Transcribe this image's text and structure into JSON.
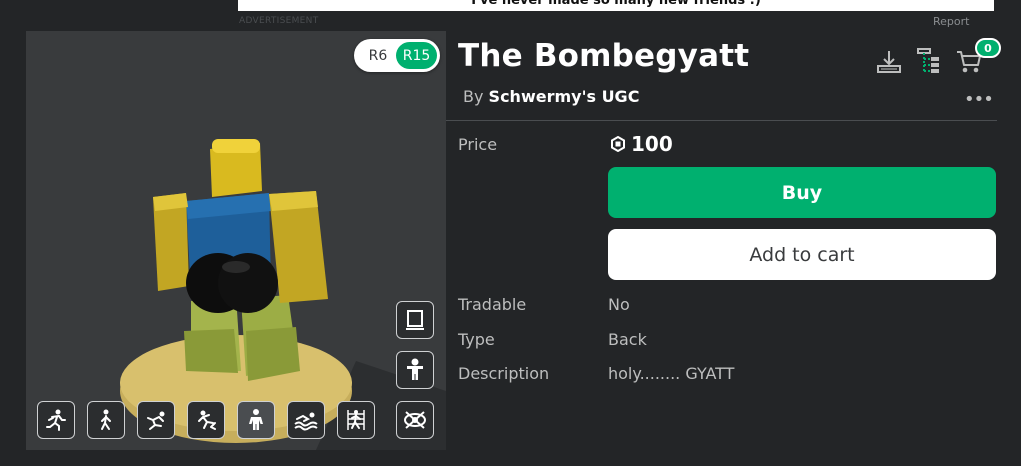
{
  "ad": {
    "banner_text": "I've never made so many new friends :)",
    "label": "ADVERTISEMENT",
    "report": "Report"
  },
  "viewer": {
    "rig_options": [
      "R6",
      "R15"
    ],
    "selected_rig": "R15",
    "side_buttons": [
      "frame-icon",
      "avatar-pose-icon",
      "hide-icon"
    ],
    "animation_buttons": [
      "run-icon",
      "walk-icon",
      "fall-icon",
      "climb-icon",
      "idle-icon",
      "swim-icon",
      "climb-ladder-icon"
    ]
  },
  "item": {
    "title": "The Bombegyatt",
    "by_label": "By",
    "creator": "Schwermy's UGC",
    "price_label": "Price",
    "price": "100",
    "buy_label": "Buy",
    "add_to_cart_label": "Add to cart",
    "tradable_label": "Tradable",
    "tradable": "No",
    "type_label": "Type",
    "type": "Back",
    "description_label": "Description",
    "description": "holy........ GYATT"
  },
  "header": {
    "cart_count": "0",
    "more": "•••"
  },
  "colors": {
    "background": "#232527",
    "viewer": "#393b3d",
    "accent_green": "#00b06f"
  }
}
